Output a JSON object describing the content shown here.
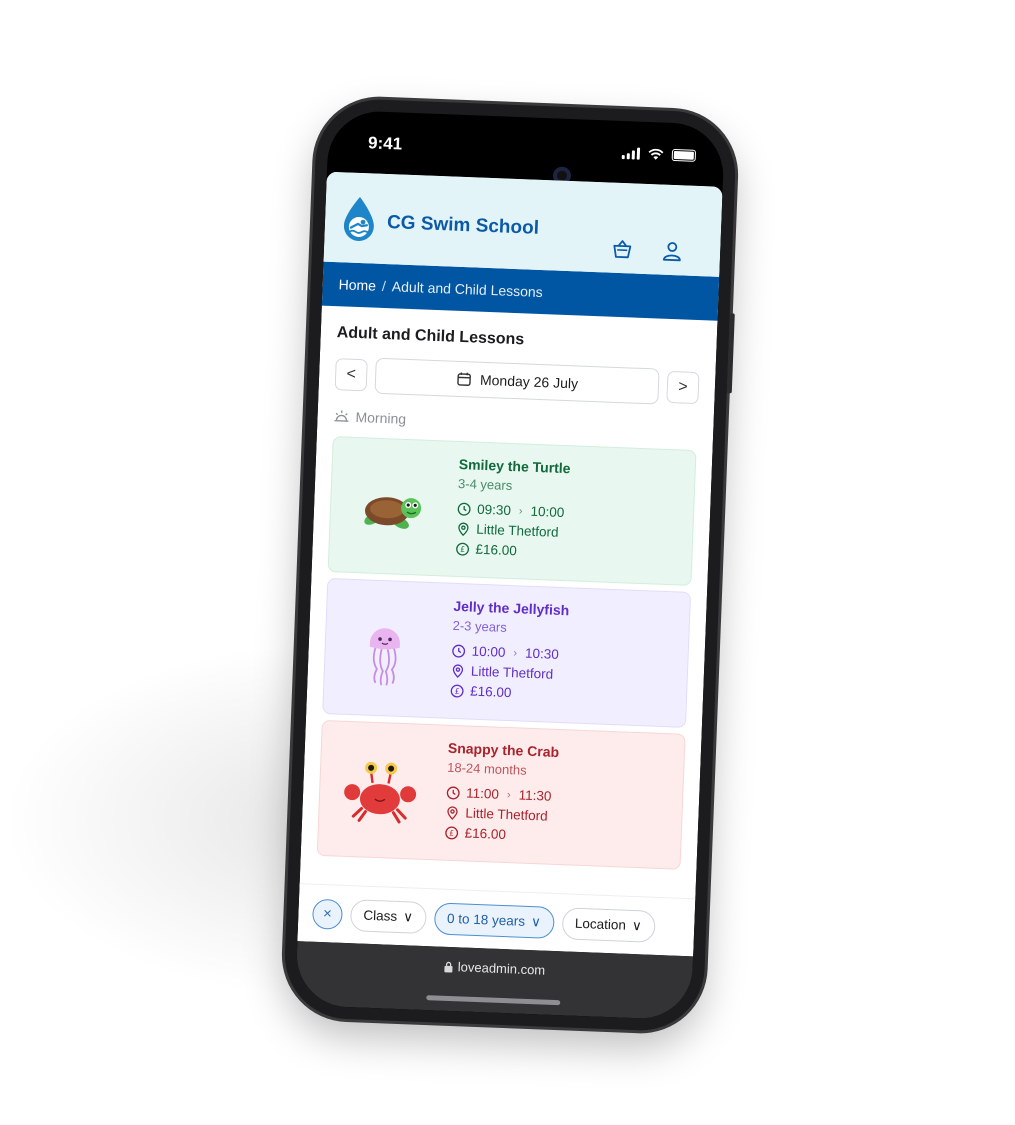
{
  "status": {
    "time": "9:41"
  },
  "header": {
    "brand": "CG Swim School"
  },
  "breadcrumb": {
    "home": "Home",
    "separator": "/",
    "current": "Adult and Child Lessons"
  },
  "page": {
    "title": "Adult and Child Lessons"
  },
  "date_nav": {
    "prev": "<",
    "date": "Monday 26 July",
    "next": ">"
  },
  "section": {
    "label": "Morning"
  },
  "lessons": [
    {
      "name": "Smiley the Turtle",
      "age": "3-4 years",
      "start": "09:30",
      "end": "10:00",
      "location": "Little Thetford",
      "price": "£16.00",
      "theme": "green",
      "icon": "turtle"
    },
    {
      "name": "Jelly the Jellyfish",
      "age": "2-3 years",
      "start": "10:00",
      "end": "10:30",
      "location": "Little Thetford",
      "price": "£16.00",
      "theme": "purple",
      "icon": "jellyfish"
    },
    {
      "name": "Snappy the Crab",
      "age": "18-24 months",
      "start": "11:00",
      "end": "11:30",
      "location": "Little Thetford",
      "price": "£16.00",
      "theme": "red",
      "icon": "crab"
    }
  ],
  "time_arrow": "›",
  "filters": {
    "clear": "×",
    "class": "Class",
    "age": "0 to 18 years",
    "location": "Location",
    "chevron": "∨"
  },
  "browser": {
    "url": "loveadmin.com"
  },
  "colors": {
    "brand_blue": "#0056a3",
    "header_bg": "#e3f4f8"
  }
}
